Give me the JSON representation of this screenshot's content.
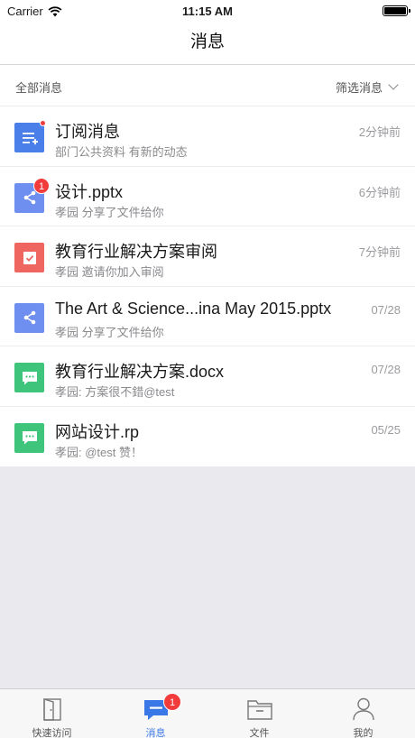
{
  "status": {
    "carrier": "Carrier",
    "time": "11:15 AM"
  },
  "nav": {
    "title": "消息"
  },
  "filter": {
    "all_label": "全部消息",
    "filter_label": "筛选消息"
  },
  "messages": [
    {
      "title": "订阅消息",
      "subtitle": "部门公共资料 有新的动态",
      "time": "2分钟前",
      "icon": "subscribe-icon",
      "color": "#4a7ee8",
      "dot": true
    },
    {
      "title": "设计.pptx",
      "subtitle": "孝园 分享了文件给你",
      "time": "6分钟前",
      "icon": "share-icon",
      "color": "#6f8ff0",
      "badge": "1"
    },
    {
      "title": "教育行业解决方案审阅",
      "subtitle": "孝园 邀请你加入审阅",
      "time": "7分钟前",
      "icon": "review-icon",
      "color": "#ef6560"
    },
    {
      "title": "The Art & Science...ina May 2015.pptx",
      "subtitle": "孝园 分享了文件给你",
      "time": "07/28",
      "icon": "share-icon",
      "color": "#6f8ff0"
    },
    {
      "title": "教育行业解决方案.docx",
      "subtitle": "孝园: 方案很不錯@test",
      "time": "07/28",
      "icon": "comment-icon",
      "color": "#3fc47c"
    },
    {
      "title": "网站设计.rp",
      "subtitle": "孝园: @test 赞！",
      "time": "05/25",
      "icon": "comment-icon",
      "color": "#3fc47c"
    }
  ],
  "tabs": [
    {
      "label": "快速访问",
      "icon": "door-icon"
    },
    {
      "label": "消息",
      "icon": "message-icon",
      "badge": "1",
      "active": true
    },
    {
      "label": "文件",
      "icon": "folder-icon"
    },
    {
      "label": "我的",
      "icon": "person-icon"
    }
  ]
}
